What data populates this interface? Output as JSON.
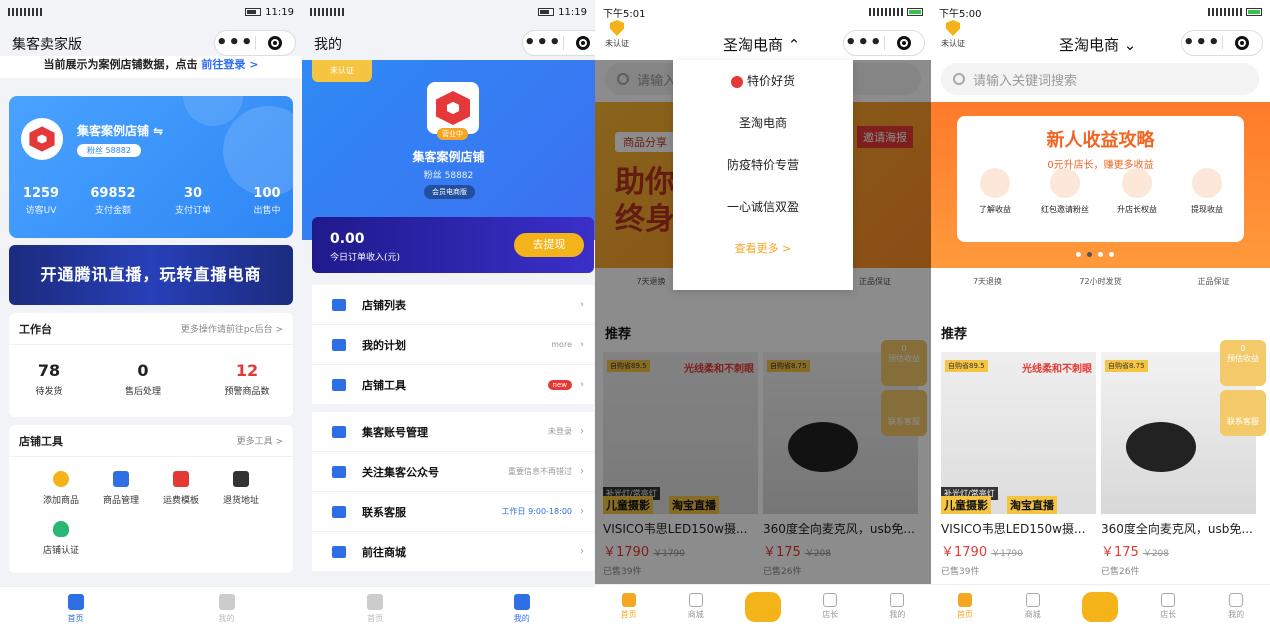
{
  "p1": {
    "status_time": "11:19",
    "nav_title": "集客卖家版",
    "notice_text": "当前展示为案例店铺数据，点击",
    "notice_link": "前往登录 >",
    "shop": {
      "name": "集客案例店铺 ⇋",
      "fans": "粉丝 58882"
    },
    "stats": [
      {
        "value": "1259",
        "label": "访客UV"
      },
      {
        "value": "69852",
        "label": "支付金额"
      },
      {
        "value": "30",
        "label": "支付订单"
      },
      {
        "value": "100",
        "label": "出售中"
      }
    ],
    "banner_text": "开通腾讯直播，玩转直播电商",
    "workbench": {
      "title": "工作台",
      "more": "更多操作请前往pc后台 >",
      "items": [
        {
          "value": "78",
          "label": "待发货"
        },
        {
          "value": "0",
          "label": "售后处理"
        },
        {
          "value": "12",
          "label": "预警商品数"
        }
      ]
    },
    "tools": {
      "title": "店铺工具",
      "more": "更多工具 >",
      "items": [
        "添加商品",
        "商品管理",
        "运费模板",
        "退货地址",
        "店铺认证"
      ]
    },
    "tabs": [
      "首页",
      "我的"
    ]
  },
  "p2": {
    "status_time": "11:19",
    "nav_title": "我的",
    "uncertified": "未认证",
    "open_tag": "营业中",
    "shop_name": "集客案例店铺",
    "fans": "粉丝 58882",
    "member": "会员电商版",
    "income_amount": "0.00",
    "income_label": "今日订单收入(元)",
    "withdraw": "去提现",
    "menu_group1": [
      {
        "label": "店铺列表",
        "side": ""
      },
      {
        "label": "我的计划",
        "side": "more"
      },
      {
        "label": "店铺工具",
        "side": "new"
      }
    ],
    "menu_group2": [
      {
        "label": "集客账号管理",
        "side": "未登录"
      },
      {
        "label": "关注集客公众号",
        "side": "重要信息不再错过"
      },
      {
        "label": "联系客服",
        "side": "工作日 9:00-18:00"
      },
      {
        "label": "前往商城",
        "side": ""
      }
    ],
    "tabs": [
      "首页",
      "我的"
    ]
  },
  "p3": {
    "status_time": "下午5:01",
    "auth": "未认证",
    "title": "圣淘电商 ⌃",
    "search_placeholder": "请输入",
    "dropdown": [
      "特价好货",
      "圣淘电商",
      "防疫特价专营",
      "一心诚信双盈"
    ],
    "dropdown_more": "查看更多 >",
    "banner_text1": "商品分享",
    "banner_text2": "助你",
    "banner_text3": "终身",
    "banner_invite": "邀请海报",
    "guarantee": [
      "7天退换",
      "",
      "正品保证"
    ],
    "floating": {
      "value": "0",
      "label": "预估收益",
      "service": "联系客服"
    }
  },
  "p4": {
    "status_time": "下午5:00",
    "auth": "未认证",
    "title": "圣淘电商 ⌄",
    "search_placeholder": "请输入关键词搜索",
    "banner": {
      "title": "新人收益攻略",
      "subtitle": "0元升店长，赚更多收益",
      "steps": [
        "了解收益",
        "红包邀请粉丝",
        "升店长权益",
        "提现收益"
      ]
    },
    "guarantee": [
      "7天退换",
      "72小时发货",
      "正品保证"
    ],
    "floating": {
      "value": "0",
      "label": "预估收益",
      "service": "联系客服"
    }
  },
  "shared": {
    "recommend": "推荐",
    "products": [
      {
        "title": "VISICO韦思LED150w摄...",
        "price": "￥1790",
        "orig": "￥1790",
        "sold": "已售39件",
        "save": "自购省89.5",
        "img_text1": "光线柔和不刺眼",
        "img_text2": "补光灯/常亮灯",
        "img_text3": "儿童摄影",
        "img_text4": "淘宝直播"
      },
      {
        "title": "360度全向麦克风，usb免...",
        "price": "￥175",
        "orig": "￥208",
        "sold": "已售26件",
        "save": "自购省8.75"
      }
    ],
    "mall_tabs": [
      "首页",
      "商城",
      "",
      "店长",
      "我的"
    ]
  }
}
